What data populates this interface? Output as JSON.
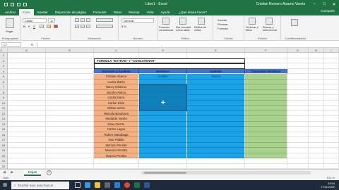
{
  "window": {
    "qat_icons": [
      "save-icon",
      "undo-icon",
      "redo-icon",
      "customize-icon"
    ],
    "title": "Libro1 - Excel",
    "user": "Cristian Romero Alzamo Varela",
    "controls": [
      "minimize-icon",
      "maximize-icon",
      "close-icon"
    ]
  },
  "ribbon_tabs": {
    "items": [
      "Archivo",
      "Inicio",
      "Insertar",
      "Disposición de página",
      "Fórmulas",
      "Datos",
      "Revisar",
      "Vista",
      "Ayuda"
    ],
    "tell_me": "¿Qué desea hacer?",
    "share": "Compartir"
  },
  "ribbon": {
    "clipboard": {
      "paste": "Pegar",
      "label": "Portapapeles"
    },
    "font": {
      "name": "Calibri",
      "size": "11",
      "label": "Fuente"
    },
    "alignment": {
      "label": "Alineación"
    },
    "number": {
      "format": "General",
      "label": "Número"
    },
    "styles": {
      "conditional": "Formato condicional",
      "table": "Dar formato como tabla",
      "cell": "Estilos de celda",
      "label": "Estilos"
    },
    "cells": {
      "insert": "Insertar",
      "delete": "Eliminar",
      "format": "Formato",
      "label": "Celdas"
    },
    "editing": {
      "sort": "Ordenar y filtrar",
      "find": "Buscar y seleccionar",
      "label": "Edición"
    },
    "sensitivity": {
      "label": "Confidencialidad"
    }
  },
  "formula_bar": {
    "name_box": "C7",
    "fx": "fx",
    "content": ""
  },
  "grid": {
    "columns": [
      "A",
      "B",
      "C",
      "D",
      "E",
      "F",
      "G",
      "H",
      "I",
      "J"
    ],
    "rows": [
      "1",
      "2",
      "3",
      "4",
      "5",
      "6",
      "7",
      "8",
      "9",
      "10",
      "11",
      "12",
      "13",
      "14",
      "15",
      "16",
      "17",
      "18",
      "19",
      "20",
      "21",
      "22",
      "23"
    ],
    "title_cell": "FORMULA \"EXTRAE\" Y \"CONCATENAR\"",
    "headers": [
      "Nombres y Apellido",
      "Nombres",
      "Apellido",
      "Caracteres Nombres"
    ],
    "people": [
      "Cristian Abarca",
      "Lectra Ibarra",
      "Nancy Mielcruz",
      "Jacobo Alarca",
      "Lindia Ibarra",
      "Karlen Elvis",
      "Mirlas varela",
      "Marcela Barahona",
      "Medardo Varela",
      "Esau Osorto",
      "Carlos Lagos",
      "Ruben Maradiaga",
      "Noe Padilla",
      "Marcelo Peralta",
      "Mauricio Peralta",
      "Bayron Peralta"
    ],
    "row1_first": "Cristian",
    "row1_last": "Abarca"
  },
  "sheets": {
    "active": "Hoja1",
    "add": "+"
  },
  "status": {
    "ready": "Listo",
    "zoom": "100 %"
  },
  "taskbar": {
    "search": "Escribir aquí para buscar",
    "icons": [
      "task-view-icon",
      "edge-icon",
      "file-explorer-icon",
      "store-icon",
      "mail-icon",
      "chrome-icon",
      "excel-icon",
      "word-icon"
    ],
    "time": "23:04",
    "date": "17/11/2020"
  },
  "colors": {
    "excel_green": "#217346",
    "header_blue": "#4472c4",
    "name_orange": "#f4b183",
    "blue": "#1aa3e8",
    "green": "#a9d18e",
    "selected": "#0e7fb8"
  }
}
